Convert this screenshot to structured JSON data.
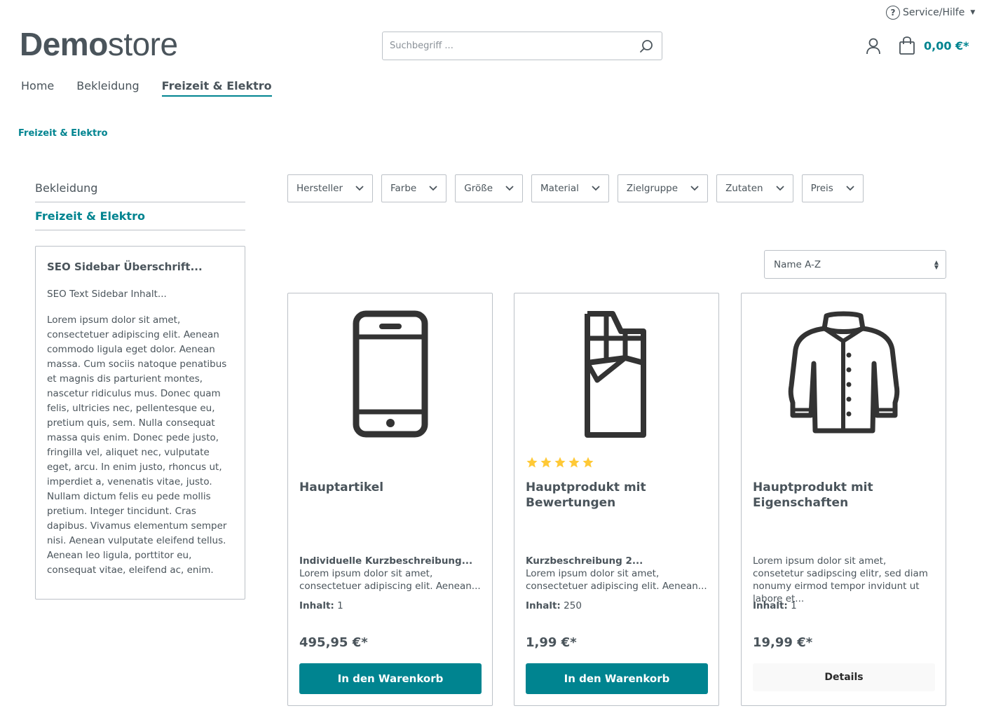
{
  "header": {
    "service_label": "Service/Hilfe",
    "logo_bold": "Demo",
    "logo_light": "store",
    "search_placeholder": "Suchbegriff ...",
    "cart_total": "0,00 €*"
  },
  "nav": {
    "items": [
      {
        "label": "Home"
      },
      {
        "label": "Bekleidung"
      },
      {
        "label": "Freizeit & Elektro",
        "active": true
      }
    ]
  },
  "breadcrumb": "Freizeit & Elektro",
  "sidebar": {
    "items": [
      {
        "label": "Bekleidung"
      },
      {
        "label": "Freizeit & Elektro",
        "active": true
      }
    ],
    "seo_title": "SEO Sidebar Überschrift...",
    "seo_intro": "SEO Text Sidebar Inhalt...",
    "seo_text": "Lorem ipsum dolor sit amet, consectetuer adipiscing elit. Aenean commodo ligula eget dolor. Aenean massa. Cum sociis natoque penatibus et magnis dis parturient montes, nascetur ridiculus mus. Donec quam felis, ultricies nec, pellentesque eu, pretium quis, sem. Nulla consequat massa quis enim. Donec pede justo, fringilla vel, aliquet nec, vulputate eget, arcu. In enim justo, rhoncus ut, imperdiet a, venenatis vitae, justo. Nullam dictum felis eu pede mollis pretium. Integer tincidunt. Cras dapibus. Vivamus elementum semper nisi. Aenean vulputate eleifend tellus. Aenean leo ligula, porttitor eu, consequat vitae, eleifend ac, enim."
  },
  "filters": [
    "Hersteller",
    "Farbe",
    "Größe",
    "Material",
    "Zielgruppe",
    "Zutaten",
    "Preis"
  ],
  "sort": {
    "selected": "Name A-Z"
  },
  "products": [
    {
      "icon": "smartphone-icon",
      "name": "Hauptartikel",
      "desc_bold": "Individuelle Kurzbeschreibung...",
      "desc": "Lorem ipsum dolor sit amet, consectetuer adipiscing elit. Aenean...",
      "content_label": "Inhalt:",
      "content_value": "1",
      "price": "495,95 €*",
      "button": "In den Warenkorb"
    },
    {
      "icon": "chocolate-bar-icon",
      "rating": 5,
      "name": "Hauptprodukt mit Bewertungen",
      "desc_bold": "Kurzbeschreibung 2...",
      "desc": "Lorem ipsum dolor sit amet, consectetuer adipiscing elit. Aenean...",
      "content_label": "Inhalt:",
      "content_value": "250",
      "price": "1,99 €*",
      "button": "In den Warenkorb"
    },
    {
      "icon": "jacket-icon",
      "name": "Hauptprodukt mit Eigenschaften",
      "desc": "Lorem ipsum dolor sit amet, consetetur sadipscing elitr, sed diam nonumy eirmod tempor invidunt ut labore et...",
      "content_label": "Inhalt:",
      "content_value": "1",
      "price": "19,99 €*",
      "button": "Details"
    }
  ],
  "colors": {
    "accent": "#008490",
    "text": "#4a545b",
    "border": "#bcc1c7",
    "star": "#ffc936"
  }
}
